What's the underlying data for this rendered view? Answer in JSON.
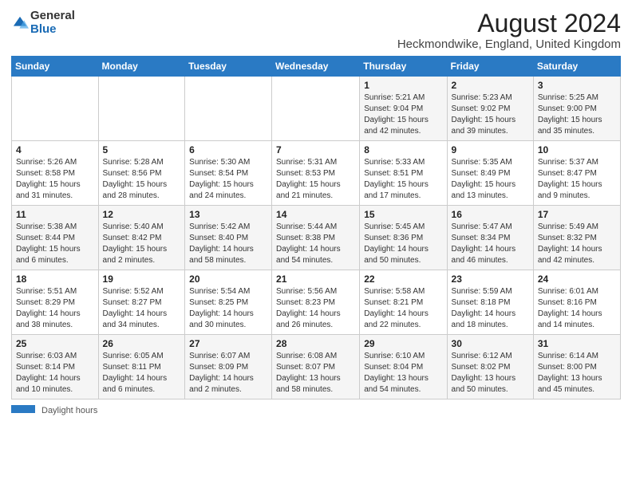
{
  "header": {
    "logo_general": "General",
    "logo_blue": "Blue",
    "main_title": "August 2024",
    "subtitle": "Heckmondwike, England, United Kingdom"
  },
  "days_of_week": [
    "Sunday",
    "Monday",
    "Tuesday",
    "Wednesday",
    "Thursday",
    "Friday",
    "Saturday"
  ],
  "footer": {
    "daylight_label": "Daylight hours"
  },
  "weeks": [
    [
      {
        "day": "",
        "info": ""
      },
      {
        "day": "",
        "info": ""
      },
      {
        "day": "",
        "info": ""
      },
      {
        "day": "",
        "info": ""
      },
      {
        "day": "1",
        "info": "Sunrise: 5:21 AM\nSunset: 9:04 PM\nDaylight: 15 hours\nand 42 minutes."
      },
      {
        "day": "2",
        "info": "Sunrise: 5:23 AM\nSunset: 9:02 PM\nDaylight: 15 hours\nand 39 minutes."
      },
      {
        "day": "3",
        "info": "Sunrise: 5:25 AM\nSunset: 9:00 PM\nDaylight: 15 hours\nand 35 minutes."
      }
    ],
    [
      {
        "day": "4",
        "info": "Sunrise: 5:26 AM\nSunset: 8:58 PM\nDaylight: 15 hours\nand 31 minutes."
      },
      {
        "day": "5",
        "info": "Sunrise: 5:28 AM\nSunset: 8:56 PM\nDaylight: 15 hours\nand 28 minutes."
      },
      {
        "day": "6",
        "info": "Sunrise: 5:30 AM\nSunset: 8:54 PM\nDaylight: 15 hours\nand 24 minutes."
      },
      {
        "day": "7",
        "info": "Sunrise: 5:31 AM\nSunset: 8:53 PM\nDaylight: 15 hours\nand 21 minutes."
      },
      {
        "day": "8",
        "info": "Sunrise: 5:33 AM\nSunset: 8:51 PM\nDaylight: 15 hours\nand 17 minutes."
      },
      {
        "day": "9",
        "info": "Sunrise: 5:35 AM\nSunset: 8:49 PM\nDaylight: 15 hours\nand 13 minutes."
      },
      {
        "day": "10",
        "info": "Sunrise: 5:37 AM\nSunset: 8:47 PM\nDaylight: 15 hours\nand 9 minutes."
      }
    ],
    [
      {
        "day": "11",
        "info": "Sunrise: 5:38 AM\nSunset: 8:44 PM\nDaylight: 15 hours\nand 6 minutes."
      },
      {
        "day": "12",
        "info": "Sunrise: 5:40 AM\nSunset: 8:42 PM\nDaylight: 15 hours\nand 2 minutes."
      },
      {
        "day": "13",
        "info": "Sunrise: 5:42 AM\nSunset: 8:40 PM\nDaylight: 14 hours\nand 58 minutes."
      },
      {
        "day": "14",
        "info": "Sunrise: 5:44 AM\nSunset: 8:38 PM\nDaylight: 14 hours\nand 54 minutes."
      },
      {
        "day": "15",
        "info": "Sunrise: 5:45 AM\nSunset: 8:36 PM\nDaylight: 14 hours\nand 50 minutes."
      },
      {
        "day": "16",
        "info": "Sunrise: 5:47 AM\nSunset: 8:34 PM\nDaylight: 14 hours\nand 46 minutes."
      },
      {
        "day": "17",
        "info": "Sunrise: 5:49 AM\nSunset: 8:32 PM\nDaylight: 14 hours\nand 42 minutes."
      }
    ],
    [
      {
        "day": "18",
        "info": "Sunrise: 5:51 AM\nSunset: 8:29 PM\nDaylight: 14 hours\nand 38 minutes."
      },
      {
        "day": "19",
        "info": "Sunrise: 5:52 AM\nSunset: 8:27 PM\nDaylight: 14 hours\nand 34 minutes."
      },
      {
        "day": "20",
        "info": "Sunrise: 5:54 AM\nSunset: 8:25 PM\nDaylight: 14 hours\nand 30 minutes."
      },
      {
        "day": "21",
        "info": "Sunrise: 5:56 AM\nSunset: 8:23 PM\nDaylight: 14 hours\nand 26 minutes."
      },
      {
        "day": "22",
        "info": "Sunrise: 5:58 AM\nSunset: 8:21 PM\nDaylight: 14 hours\nand 22 minutes."
      },
      {
        "day": "23",
        "info": "Sunrise: 5:59 AM\nSunset: 8:18 PM\nDaylight: 14 hours\nand 18 minutes."
      },
      {
        "day": "24",
        "info": "Sunrise: 6:01 AM\nSunset: 8:16 PM\nDaylight: 14 hours\nand 14 minutes."
      }
    ],
    [
      {
        "day": "25",
        "info": "Sunrise: 6:03 AM\nSunset: 8:14 PM\nDaylight: 14 hours\nand 10 minutes."
      },
      {
        "day": "26",
        "info": "Sunrise: 6:05 AM\nSunset: 8:11 PM\nDaylight: 14 hours\nand 6 minutes."
      },
      {
        "day": "27",
        "info": "Sunrise: 6:07 AM\nSunset: 8:09 PM\nDaylight: 14 hours\nand 2 minutes."
      },
      {
        "day": "28",
        "info": "Sunrise: 6:08 AM\nSunset: 8:07 PM\nDaylight: 13 hours\nand 58 minutes."
      },
      {
        "day": "29",
        "info": "Sunrise: 6:10 AM\nSunset: 8:04 PM\nDaylight: 13 hours\nand 54 minutes."
      },
      {
        "day": "30",
        "info": "Sunrise: 6:12 AM\nSunset: 8:02 PM\nDaylight: 13 hours\nand 50 minutes."
      },
      {
        "day": "31",
        "info": "Sunrise: 6:14 AM\nSunset: 8:00 PM\nDaylight: 13 hours\nand 45 minutes."
      }
    ]
  ]
}
